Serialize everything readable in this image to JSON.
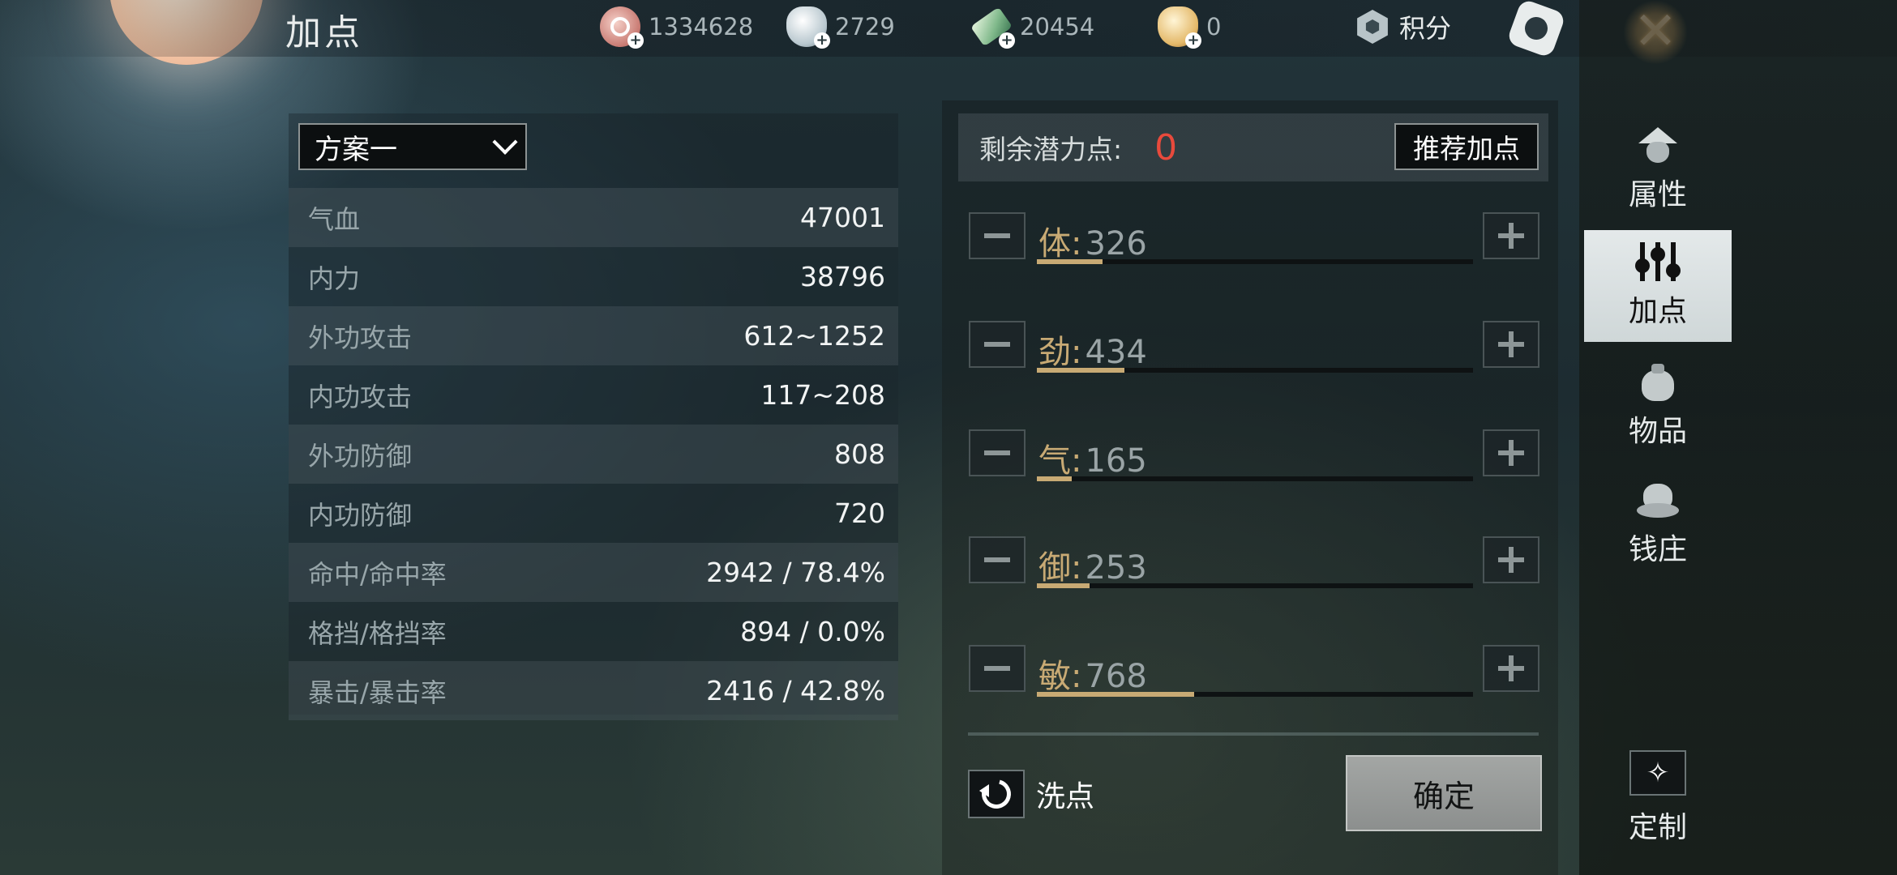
{
  "header": {
    "title": "加点",
    "currencies": [
      {
        "icon": "coin-icon",
        "value": "1334628"
      },
      {
        "icon": "silver-ingot-icon",
        "value": "2729"
      },
      {
        "icon": "jade-ticket-icon",
        "value": "20454"
      },
      {
        "icon": "gold-ingot-icon",
        "value": "0"
      }
    ],
    "score_label": "积分"
  },
  "scheme": {
    "selected": "方案一"
  },
  "stats": [
    {
      "label": "气血",
      "value": "47001"
    },
    {
      "label": "内力",
      "value": "38796"
    },
    {
      "label": "外功攻击",
      "value": "612~1252"
    },
    {
      "label": "内功攻击",
      "value": "117~208"
    },
    {
      "label": "外功防御",
      "value": "808"
    },
    {
      "label": "内功防御",
      "value": "720"
    },
    {
      "label": "命中/命中率",
      "value": "2942 / 78.4%"
    },
    {
      "label": "格挡/格挡率",
      "value": "894 / 0.0%"
    },
    {
      "label": "暴击/暴击率",
      "value": "2416 / 42.8%"
    }
  ],
  "allocation": {
    "remaining_label": "剩余潜力点:",
    "remaining_value": "0",
    "recommend_label": "推荐加点",
    "attributes": [
      {
        "name": "体",
        "colon": ":",
        "value": "326",
        "fill": 0.15
      },
      {
        "name": "劲",
        "colon": ":",
        "value": "434",
        "fill": 0.2
      },
      {
        "name": "气",
        "colon": ":",
        "value": "165",
        "fill": 0.08
      },
      {
        "name": "御",
        "colon": ":",
        "value": "253",
        "fill": 0.12
      },
      {
        "name": "敏",
        "colon": ":",
        "value": "768",
        "fill": 0.36
      }
    ],
    "reset_label": "洗点",
    "confirm_label": "确定"
  },
  "nav": {
    "items": [
      {
        "label": "属性",
        "icon": "hat-icon"
      },
      {
        "label": "加点",
        "icon": "sliders-icon"
      },
      {
        "label": "物品",
        "icon": "bag-icon"
      },
      {
        "label": "钱庄",
        "icon": "money-bag-icon"
      }
    ],
    "custom_label": "定制"
  },
  "colors": {
    "remaining_value": "#e84a3c",
    "attr_name": "#c8aa74",
    "active_nav_bg": "#dfe5e6"
  }
}
